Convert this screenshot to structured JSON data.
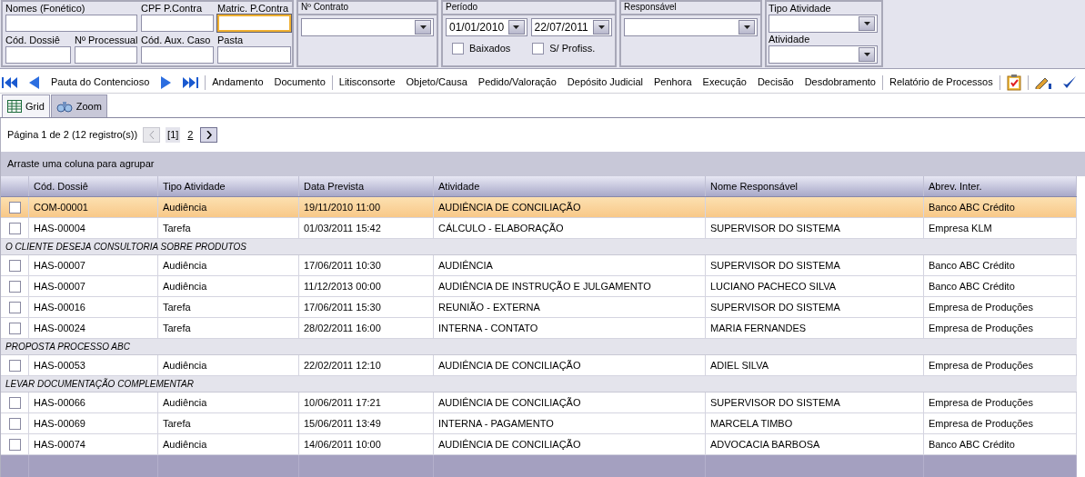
{
  "filters": {
    "fields": [
      {
        "label": "Nomes (Fonético)",
        "focused": false
      },
      {
        "label": "CPF P.Contra",
        "focused": false
      },
      {
        "label": "Matric. P.Contra",
        "focused": true
      },
      {
        "label": "Cód. Dossiê",
        "focused": false
      },
      {
        "label": "Nº Processual",
        "focused": false
      },
      {
        "label": "Cód. Aux. Caso",
        "focused": false
      },
      {
        "label": "Pasta",
        "focused": false
      }
    ],
    "contrato": {
      "title": "Nº Contrato"
    },
    "periodo": {
      "title": "Período",
      "from": "01/01/2010",
      "to": "22/07/2011",
      "checks": [
        {
          "label": "Baixados",
          "checked": false
        },
        {
          "label": "S/ Profiss.",
          "checked": false
        }
      ]
    },
    "responsavel": {
      "title": "Responsável"
    },
    "atividade": {
      "fields": [
        {
          "label": "Tipo Atividade"
        },
        {
          "label": "Atividade"
        }
      ]
    }
  },
  "toolbar": [
    {
      "kind": "first"
    },
    {
      "kind": "prev"
    },
    {
      "kind": "link",
      "label": "Pauta do Contencioso"
    },
    {
      "kind": "next"
    },
    {
      "kind": "last"
    },
    {
      "kind": "sep"
    },
    {
      "kind": "link",
      "label": "Andamento"
    },
    {
      "kind": "link",
      "label": "Documento"
    },
    {
      "kind": "sep"
    },
    {
      "kind": "link",
      "label": "Litisconsorte"
    },
    {
      "kind": "link",
      "label": "Objeto/Causa"
    },
    {
      "kind": "link",
      "label": "Pedido/Valoração"
    },
    {
      "kind": "link",
      "label": "Depósito Judicial"
    },
    {
      "kind": "link",
      "label": "Penhora"
    },
    {
      "kind": "link",
      "label": "Execução"
    },
    {
      "kind": "link",
      "label": "Decisão"
    },
    {
      "kind": "link",
      "label": "Desdobramento"
    },
    {
      "kind": "sep"
    },
    {
      "kind": "link",
      "label": "Relatório de Processos"
    },
    {
      "kind": "sep"
    },
    {
      "kind": "clipboard"
    },
    {
      "kind": "sep"
    },
    {
      "kind": "pen"
    },
    {
      "kind": "check"
    }
  ],
  "tabs": [
    {
      "label": "Grid",
      "selected": true,
      "kind": "grid"
    },
    {
      "label": "Zoom",
      "selected": false,
      "kind": "zoom"
    }
  ],
  "pager": {
    "summary": "Página 1 de 2 (12 registro(s))",
    "prev_disabled": true,
    "pages": [
      {
        "label": "[1]",
        "selected": true
      },
      {
        "label": "2",
        "selected": false
      }
    ]
  },
  "group_panel": "Arraste uma coluna para agrupar",
  "table": {
    "columns": [
      "Cód. Dossiê",
      "Tipo Atividade",
      "Data Prevista",
      "Atividade",
      "Nome Responsável",
      "Abrev. Inter."
    ],
    "rows": [
      {
        "kind": "row",
        "selected": true,
        "checked": false,
        "cells": [
          "COM-00001",
          "Audiência",
          "19/11/2010 11:00",
          "AUDIÊNCIA DE CONCILIAÇÃO",
          "",
          "Banco ABC Crédito"
        ]
      },
      {
        "kind": "row",
        "selected": false,
        "checked": false,
        "cells": [
          "HAS-00004",
          "Tarefa",
          "01/03/2011 15:42",
          "CÁLCULO - ELABORAÇÃO",
          "SUPERVISOR DO SISTEMA",
          "Empresa KLM"
        ]
      },
      {
        "kind": "group",
        "label": "O CLIENTE DESEJA CONSULTORIA SOBRE PRODUTOS"
      },
      {
        "kind": "row",
        "selected": false,
        "checked": false,
        "cells": [
          "HAS-00007",
          "Audiência",
          "17/06/2011 10:30",
          "AUDIÊNCIA",
          "SUPERVISOR DO SISTEMA",
          "Banco ABC Crédito"
        ]
      },
      {
        "kind": "row",
        "selected": false,
        "checked": false,
        "cells": [
          "HAS-00007",
          "Audiência",
          "11/12/2013 00:00",
          "AUDIÊNCIA DE INSTRUÇÃO E JULGAMENTO",
          "LUCIANO PACHECO SILVA",
          "Banco ABC Crédito"
        ]
      },
      {
        "kind": "row",
        "selected": false,
        "checked": false,
        "cells": [
          "HAS-00016",
          "Tarefa",
          "17/06/2011 15:30",
          "REUNIÃO - EXTERNA",
          "SUPERVISOR DO SISTEMA",
          "Empresa de Produções"
        ]
      },
      {
        "kind": "row",
        "selected": false,
        "checked": false,
        "cells": [
          "HAS-00024",
          "Tarefa",
          "28/02/2011 16:00",
          "INTERNA - CONTATO",
          "MARIA FERNANDES",
          "Empresa de Produções"
        ]
      },
      {
        "kind": "group",
        "label": "PROPOSTA PROCESSO ABC"
      },
      {
        "kind": "row",
        "selected": false,
        "checked": false,
        "cells": [
          "HAS-00053",
          "Audiência",
          "22/02/2011 12:10",
          "AUDIÊNCIA DE CONCILIAÇÃO",
          "ADIEL SILVA",
          "Empresa de Produções"
        ]
      },
      {
        "kind": "group",
        "label": "LEVAR DOCUMENTAÇÃO COMPLEMENTAR"
      },
      {
        "kind": "row",
        "selected": false,
        "checked": false,
        "cells": [
          "HAS-00066",
          "Audiência",
          "10/06/2011 17:21",
          "AUDIÊNCIA DE CONCILIAÇÃO",
          "SUPERVISOR DO SISTEMA",
          "Empresa de Produções"
        ]
      },
      {
        "kind": "row",
        "selected": false,
        "checked": false,
        "cells": [
          "HAS-00069",
          "Tarefa",
          "15/06/2011 13:49",
          "INTERNA - PAGAMENTO",
          "MARCELA TIMBO",
          "Empresa de Produções"
        ]
      },
      {
        "kind": "row",
        "selected": false,
        "checked": false,
        "cells": [
          "HAS-00074",
          "Audiência",
          "14/06/2011 10:00",
          "AUDIÊNCIA DE CONCILIAÇÃO",
          "ADVOCACIA BARBOSA",
          "Banco ABC Crédito"
        ]
      }
    ]
  }
}
